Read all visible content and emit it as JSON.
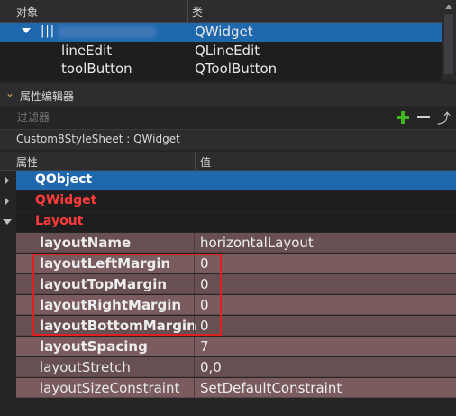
{
  "object_inspector": {
    "columns": [
      "对象",
      "类"
    ],
    "rows": [
      {
        "name": "",
        "class": "QWidget",
        "selected": true
      },
      {
        "name": "lineEdit",
        "class": "QLineEdit"
      },
      {
        "name": "toolButton",
        "class": "QToolButton"
      }
    ]
  },
  "property_editor": {
    "title": "属性编辑器",
    "filter_placeholder": "过滤器",
    "add_icon": "plus-icon",
    "remove_icon": "minus-icon",
    "configure_icon": "wrench-icon",
    "class_line": "Custom8StyleSheet : QWidget",
    "columns": [
      "属性",
      "值"
    ],
    "sections": [
      "QObject",
      "QWidget",
      "Layout"
    ],
    "properties": [
      {
        "name": "layoutName",
        "value": "horizontalLayout"
      },
      {
        "name": "layoutLeftMargin",
        "value": "0"
      },
      {
        "name": "layoutTopMargin",
        "value": "0"
      },
      {
        "name": "layoutRightMargin",
        "value": "0"
      },
      {
        "name": "layoutBottomMargin",
        "value": "0"
      },
      {
        "name": "layoutSpacing",
        "value": "7"
      },
      {
        "name": "layoutStretch",
        "value": "0,0"
      },
      {
        "name": "layoutSizeConstraint",
        "value": "SetDefaultConstraint"
      }
    ]
  },
  "colors": {
    "selection": "#1f68ad",
    "section_text_red": "#ff3b3b",
    "layout_row_bg": "#674f52",
    "highlight_border": "#e02020",
    "add_green": "#3fb61e"
  }
}
